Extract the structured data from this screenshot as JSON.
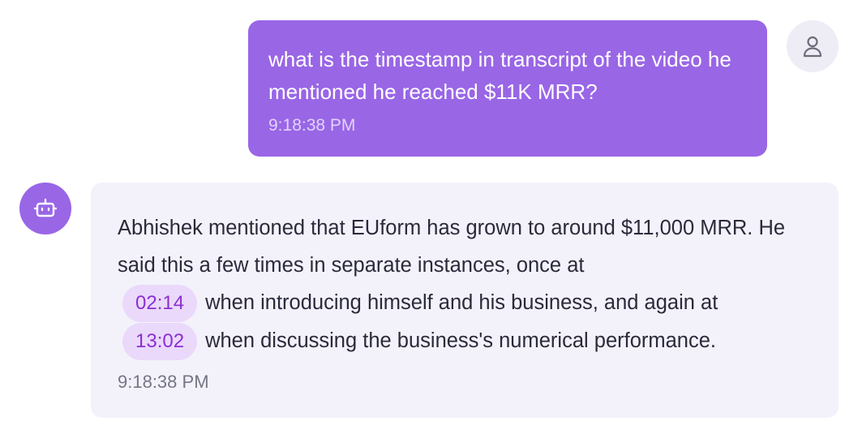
{
  "user_message": {
    "text": "what is the timestamp in transcript of the video he mentioned he reached $11K MRR?",
    "time": "9:18:38 PM"
  },
  "bot_message": {
    "intro": "Abhishek mentioned that EUform has grown to around $11,000 MRR. He said this a few times in separate instances, once at",
    "timestamp_1": "02:14",
    "middle": "when introducing himself and his business, and again at",
    "timestamp_2": "13:02",
    "end": "when discussing the business's numerical performance.",
    "time": "9:18:38 PM"
  },
  "icons": {
    "user_avatar": "user-icon",
    "bot_avatar": "robot-icon"
  },
  "colors": {
    "accent": "#9966e6",
    "bot_bubble_bg": "#f3f2fb",
    "timestamp_chip_bg": "#ead9fb",
    "timestamp_chip_text": "#8c2fd1"
  }
}
